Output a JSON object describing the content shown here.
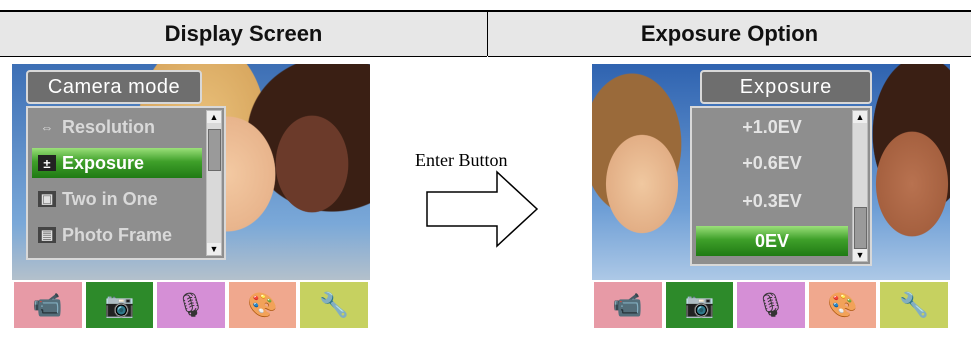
{
  "headers": {
    "left": "Display Screen",
    "right": "Exposure Option"
  },
  "left_screen": {
    "menu_title": "Camera mode",
    "items": [
      {
        "label": "Resolution",
        "icon": "resolution-icon"
      },
      {
        "label": "Exposure",
        "icon": "exposure-icon",
        "selected": true
      },
      {
        "label": "Two in One",
        "icon": "two-in-one-icon"
      },
      {
        "label": "Photo Frame",
        "icon": "photo-frame-icon"
      }
    ]
  },
  "right_screen": {
    "menu_title": "Exposure",
    "options": [
      "+1.0EV",
      "+0.6EV",
      "+0.3EV",
      "0EV"
    ],
    "selected": "0EV"
  },
  "transition": {
    "label": "Enter Button"
  },
  "bottom_bar_icons": [
    "camcorder-icon",
    "camera-icon",
    "microphone-icon",
    "palette-icon",
    "tools-icon"
  ],
  "colors": {
    "selected_green": "#3fa02a",
    "menu_gray": "#8e8e8e"
  }
}
